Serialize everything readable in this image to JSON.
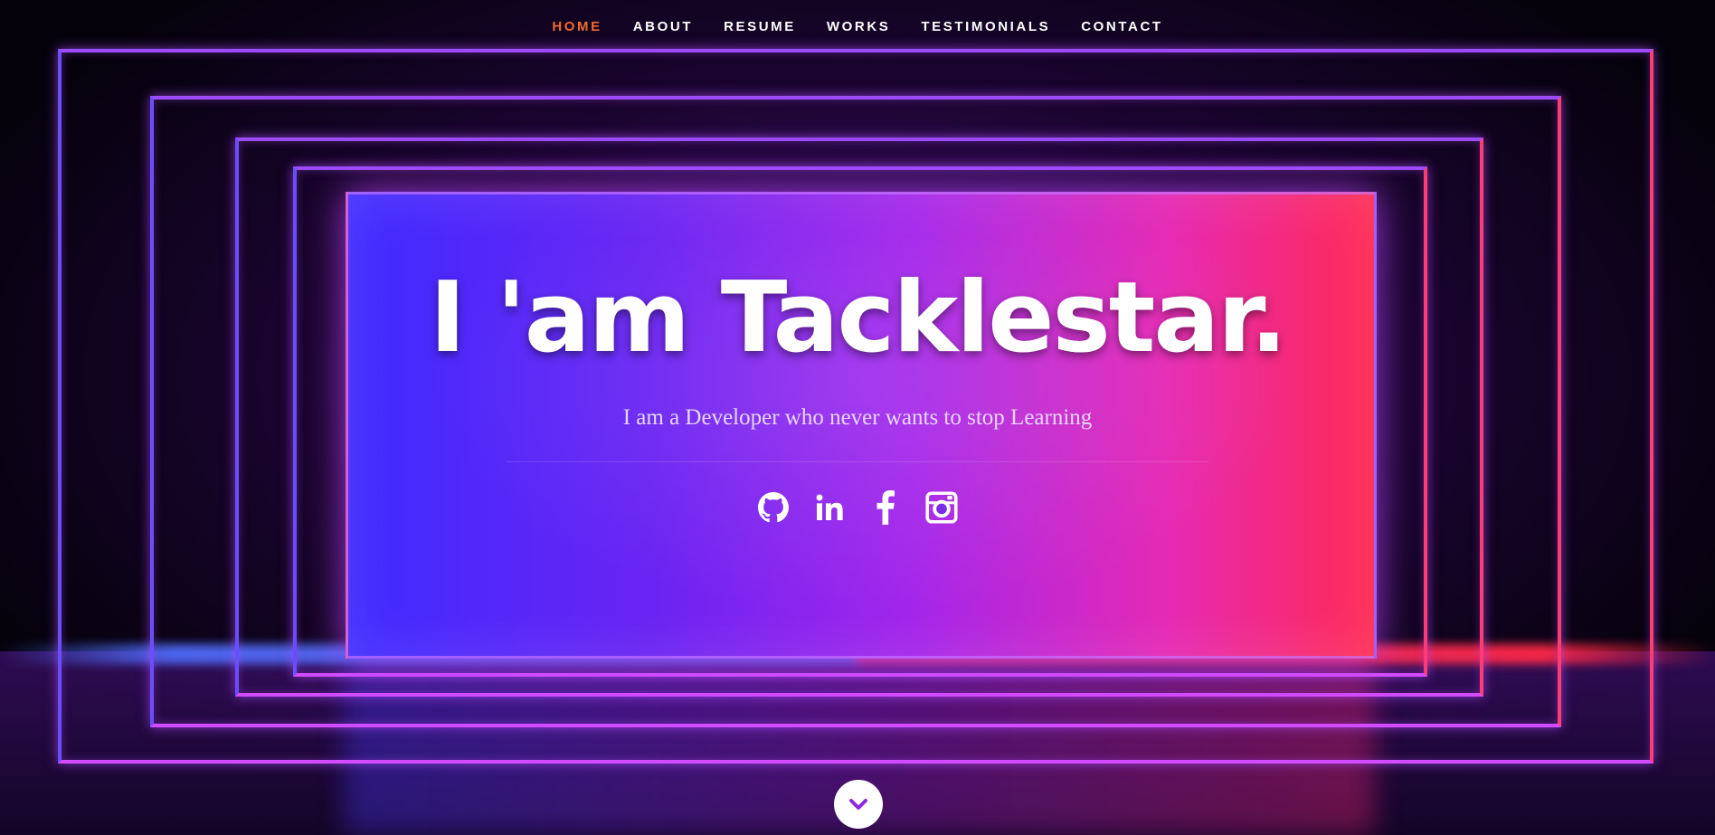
{
  "nav": {
    "items": [
      {
        "label": "HOME",
        "active": true
      },
      {
        "label": "ABOUT",
        "active": false
      },
      {
        "label": "RESUME",
        "active": false
      },
      {
        "label": "WORKS",
        "active": false
      },
      {
        "label": "TESTIMONIALS",
        "active": false
      },
      {
        "label": "CONTACT",
        "active": false
      }
    ],
    "active_color": "#f06a2c"
  },
  "hero": {
    "title": "I 'am Tacklestar.",
    "subtitle": "I am a Developer who never wants to stop Learning"
  },
  "socials": [
    {
      "icon": "github-icon"
    },
    {
      "icon": "linkedin-icon"
    },
    {
      "icon": "facebook-icon"
    },
    {
      "icon": "instagram-icon"
    }
  ],
  "scroll_down": {
    "icon": "chevron-down-icon"
  },
  "colors": {
    "neon_blue": "#3f2bff",
    "neon_purple": "#a326ea",
    "neon_pink": "#e52ab4",
    "neon_red": "#ff2a54"
  }
}
